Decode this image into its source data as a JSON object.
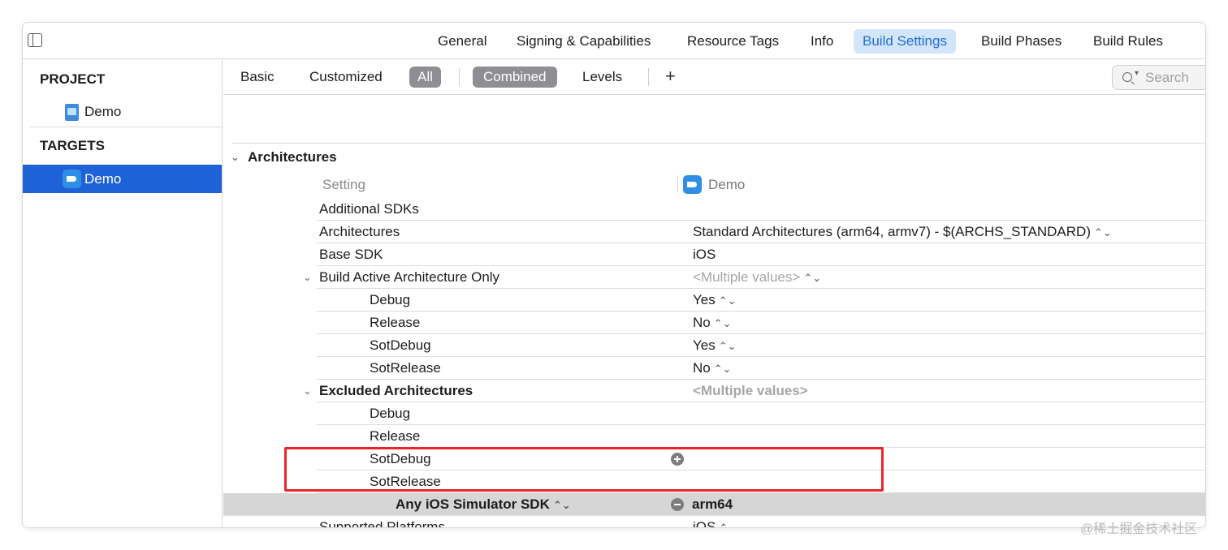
{
  "editor_tabs": [
    {
      "label": "General"
    },
    {
      "label": "Signing & Capabilities"
    },
    {
      "label": "Resource Tags"
    },
    {
      "label": "Info"
    },
    {
      "label": "Build Settings",
      "active": true
    },
    {
      "label": "Build Phases"
    },
    {
      "label": "Build Rules"
    }
  ],
  "navigator": {
    "project_heading": "PROJECT",
    "project_item": "Demo",
    "targets_heading": "TARGETS",
    "target_item": "Demo"
  },
  "filters": {
    "basic": "Basic",
    "customized": "Customized",
    "all": "All",
    "combined": "Combined",
    "levels": "Levels",
    "add": "+"
  },
  "search": {
    "placeholder": "Search"
  },
  "section": {
    "title": "Architectures"
  },
  "columns": {
    "setting": "Setting",
    "target": "Demo"
  },
  "rows": [
    {
      "name": "Additional SDKs",
      "value": ""
    },
    {
      "name": "Architectures",
      "value": "Standard Architectures (arm64, armv7)  -  $(ARCHS_STANDARD)"
    },
    {
      "name": "Base SDK",
      "value": "iOS"
    },
    {
      "name": "Build Active Architecture Only",
      "value": "<Multiple values>"
    },
    {
      "name": "Debug",
      "value": "Yes"
    },
    {
      "name": "Release",
      "value": "No"
    },
    {
      "name": "SotDebug",
      "value": "Yes"
    },
    {
      "name": "SotRelease",
      "value": "No"
    },
    {
      "name": "Excluded Architectures",
      "value": "<Multiple values>"
    },
    {
      "name": "Debug",
      "value": ""
    },
    {
      "name": "Release",
      "value": ""
    },
    {
      "name": "SotDebug",
      "value": ""
    },
    {
      "name": "SotRelease",
      "value": ""
    },
    {
      "name": "Any iOS Simulator SDK",
      "value": "arm64"
    },
    {
      "name": "Supported Platforms",
      "value": "iOS"
    }
  ],
  "glyphs": {
    "stepper": "⌃⌄",
    "disclosure_open": "⌄",
    "search_menu": "▾"
  },
  "watermark": "@稀土掘金技术社区",
  "colors": {
    "accent": "#1f62d8",
    "tab_active_bg": "#d3e5f8",
    "tab_active_text": "#1f6fd1",
    "annotation": "#e8262a",
    "row_highlight": "#d6d6d6",
    "pill": "#8e8e93"
  }
}
